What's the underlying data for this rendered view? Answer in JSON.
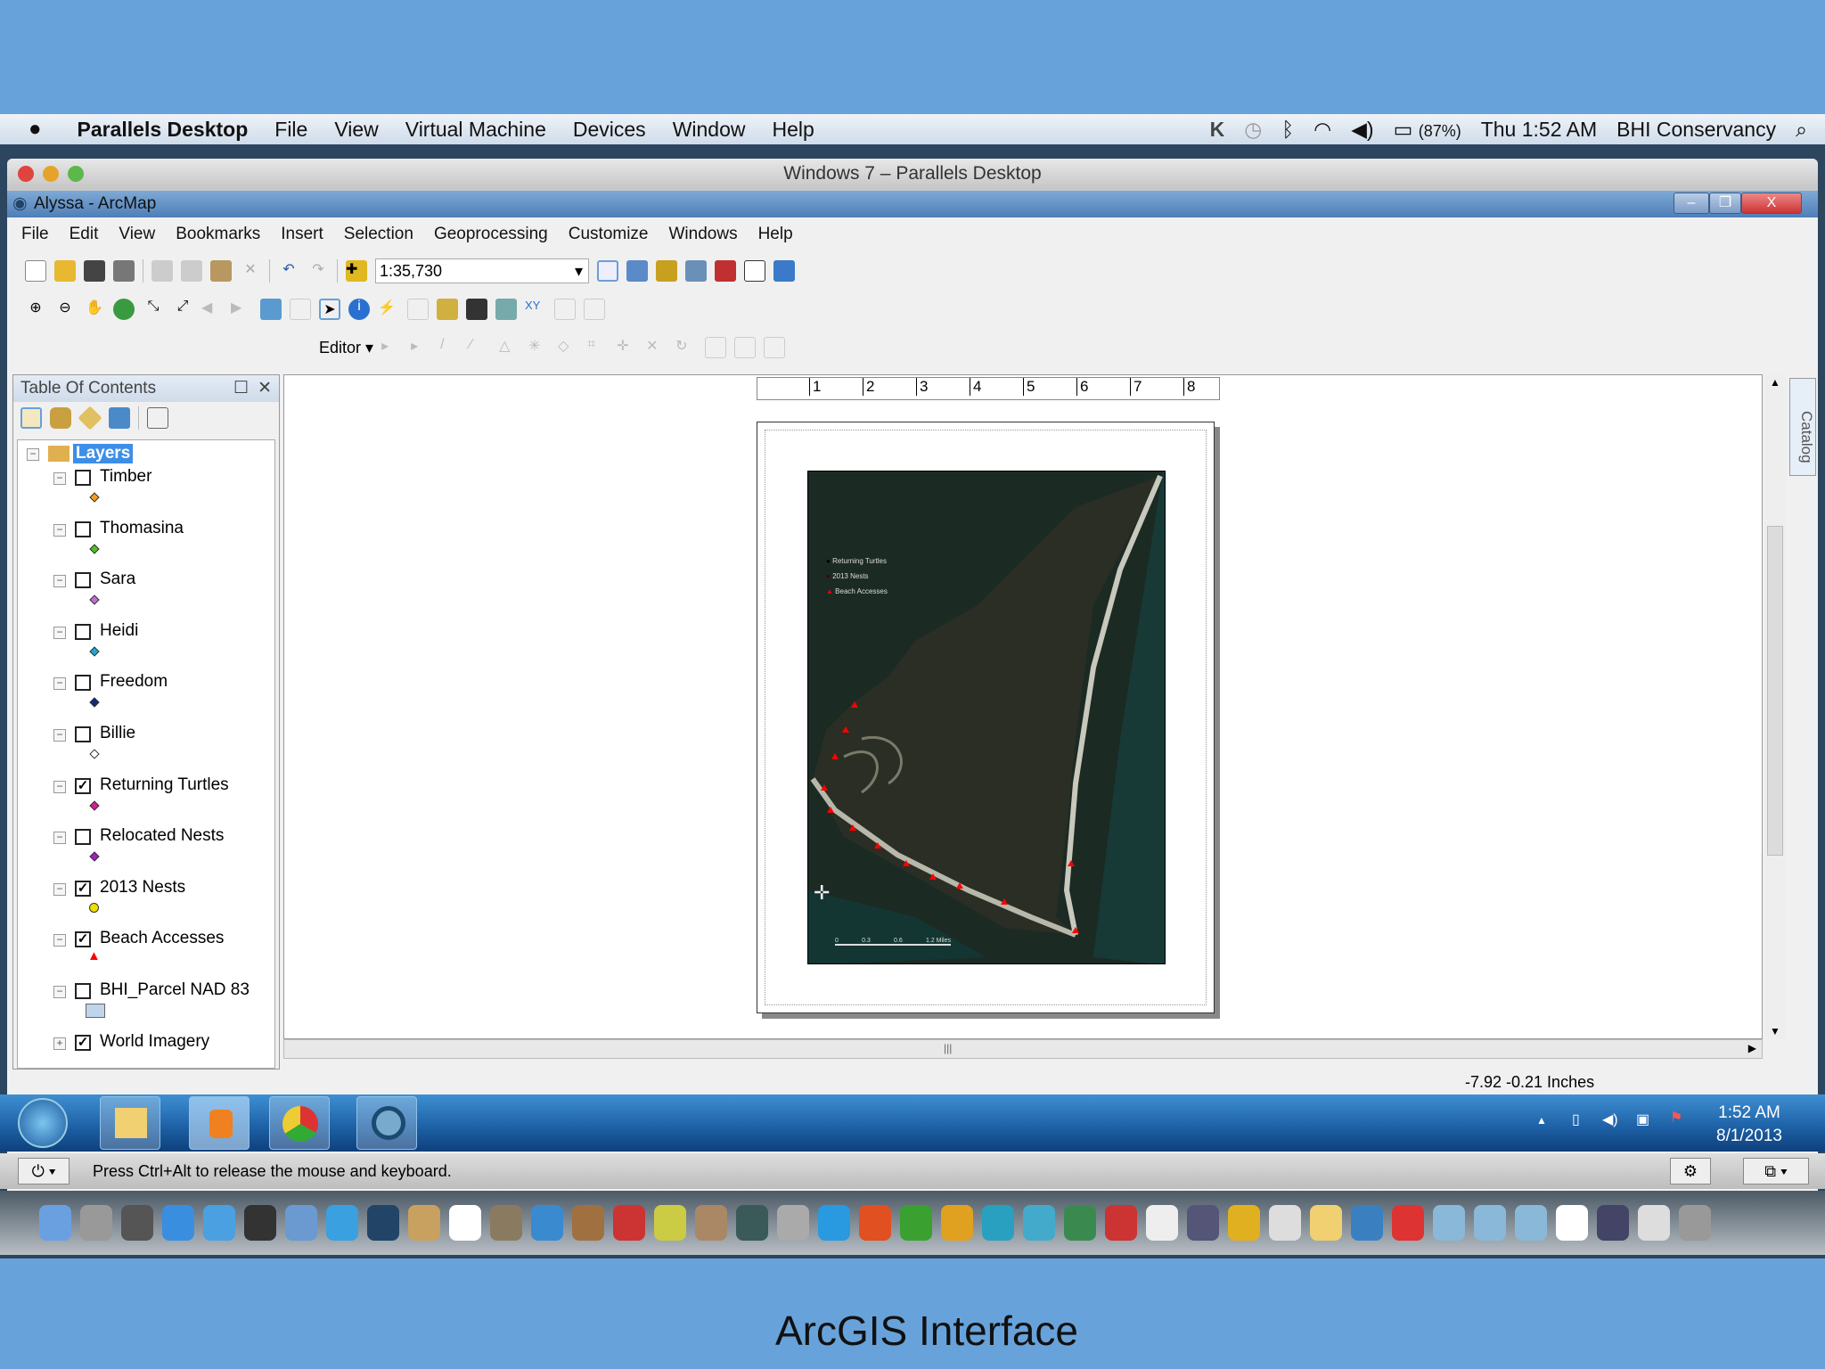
{
  "mac_menubar": {
    "app": "Parallels Desktop",
    "items": [
      "File",
      "View",
      "Virtual Machine",
      "Devices",
      "Window",
      "Help"
    ],
    "battery": "(87%)",
    "clock": "Thu 1:52 AM",
    "user": "BHI Conservancy"
  },
  "parallels_window": {
    "title": "Windows 7 – Parallels Desktop"
  },
  "arcmap": {
    "title": "Alyssa - ArcMap",
    "menu": [
      "File",
      "Edit",
      "View",
      "Bookmarks",
      "Insert",
      "Selection",
      "Geoprocessing",
      "Customize",
      "Windows",
      "Help"
    ],
    "scale": "1:35,730",
    "editor_label": "Editor"
  },
  "toc": {
    "title": "Table Of Contents",
    "root": "Layers",
    "layers": [
      {
        "name": "Timber",
        "checked": false,
        "color": "#f0a020",
        "sym": "diamond"
      },
      {
        "name": "Thomasina",
        "checked": false,
        "color": "#50c020",
        "sym": "diamond"
      },
      {
        "name": "Sara",
        "checked": false,
        "color": "#c070d0",
        "sym": "diamond"
      },
      {
        "name": "Heidi",
        "checked": false,
        "color": "#20a8d0",
        "sym": "diamond"
      },
      {
        "name": "Freedom",
        "checked": false,
        "color": "#102880",
        "sym": "diamond"
      },
      {
        "name": "Billie",
        "checked": false,
        "color": "#ffffff",
        "sym": "diamond"
      },
      {
        "name": "Returning Turtles",
        "checked": true,
        "color": "#d02090",
        "sym": "diamond"
      },
      {
        "name": "Relocated Nests",
        "checked": false,
        "color": "#a020c0",
        "sym": "diamond"
      },
      {
        "name": "2013 Nests",
        "checked": true,
        "color": "#f0e000",
        "sym": "circle"
      },
      {
        "name": "Beach Accesses",
        "checked": true,
        "color": "#ff0000",
        "sym": "triangle"
      },
      {
        "name": "BHI_Parcel NAD 83",
        "checked": false,
        "color": "#c0d4ec",
        "sym": "rect"
      },
      {
        "name": "World Imagery",
        "checked": true,
        "color": "",
        "sym": "none",
        "collapsed": true
      }
    ]
  },
  "ruler": [
    "1",
    "2",
    "3",
    "4",
    "5",
    "6",
    "7",
    "8"
  ],
  "map_legend": [
    "Returning Turtles",
    "2013 Nests",
    "Beach Accesses"
  ],
  "map_scalebar": [
    "0",
    "0.3",
    "0.6",
    "1.2 Miles"
  ],
  "status": {
    "coords": "-7.92  -0.21 Inches"
  },
  "taskbar": {
    "time": "1:52 AM",
    "date": "8/1/2013"
  },
  "parallels_status": "Press Ctrl+Alt to release the mouse and keyboard.",
  "dock_icons": [
    "finder",
    "launchpad",
    "mission-control",
    "app-store",
    "safari",
    "dashboard",
    "preview",
    "facetime",
    "photo-booth",
    "notes",
    "calendar",
    "iphoto",
    "itunes",
    "image-capture",
    "photo-app",
    "imovie",
    "garageband",
    "time-machine",
    "system-prefs",
    "word",
    "powerpoint",
    "excel",
    "outlook",
    "communicator",
    "messenger",
    "network",
    "parallels",
    "textedit",
    "vmware",
    "adium",
    "stickies",
    "folder",
    "globe",
    "chrome",
    "applications",
    "documents",
    "downloads",
    "file",
    "hyperterminal",
    "screen",
    "trash"
  ],
  "caption": "ArcGIS Interface"
}
